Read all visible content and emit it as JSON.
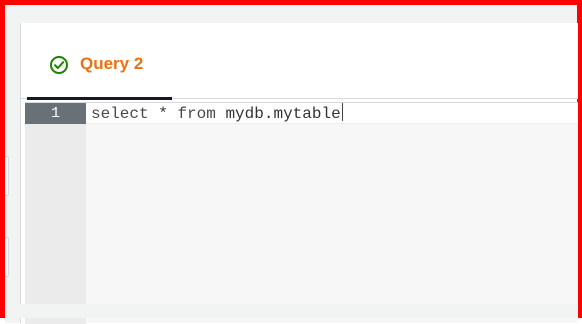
{
  "tabs": [
    {
      "label": "Query 2",
      "status_icon": "check-circle-icon",
      "active": true
    }
  ],
  "editor": {
    "line_numbers": [
      "1"
    ],
    "lines": [
      {
        "keyword_select": "select",
        "symbol_star": "*",
        "keyword_from": "from",
        "table_name": "mydb.mytable"
      }
    ]
  },
  "colors": {
    "accent": "#ec7211",
    "success": "#1d8102",
    "gutter_active": "#687078",
    "frame": "#ff0000"
  }
}
